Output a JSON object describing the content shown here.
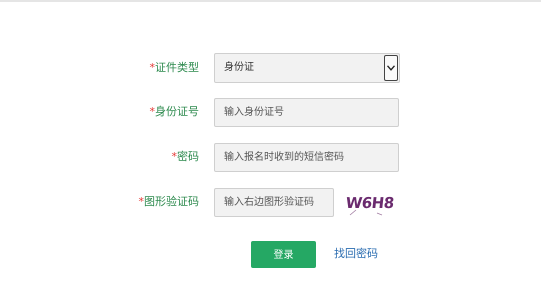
{
  "form": {
    "id_type": {
      "required_mark": "*",
      "label": "证件类型",
      "value": "身份证"
    },
    "id_number": {
      "required_mark": "*",
      "label": "身份证号",
      "placeholder": "输入身份证号"
    },
    "password": {
      "required_mark": "*",
      "label": "密码",
      "placeholder": "输入报名时收到的短信密码"
    },
    "captcha": {
      "required_mark": "*",
      "label": "图形验证码",
      "placeholder": "输入右边图形验证码",
      "image_text": "W6H8"
    },
    "login_button": "登录",
    "forgot_link": "找回密码"
  },
  "colors": {
    "label": "#2d8a4e",
    "required": "#e53935",
    "button": "#25a864",
    "link": "#2a6cb0",
    "captcha_text": "#6a2a6e"
  }
}
